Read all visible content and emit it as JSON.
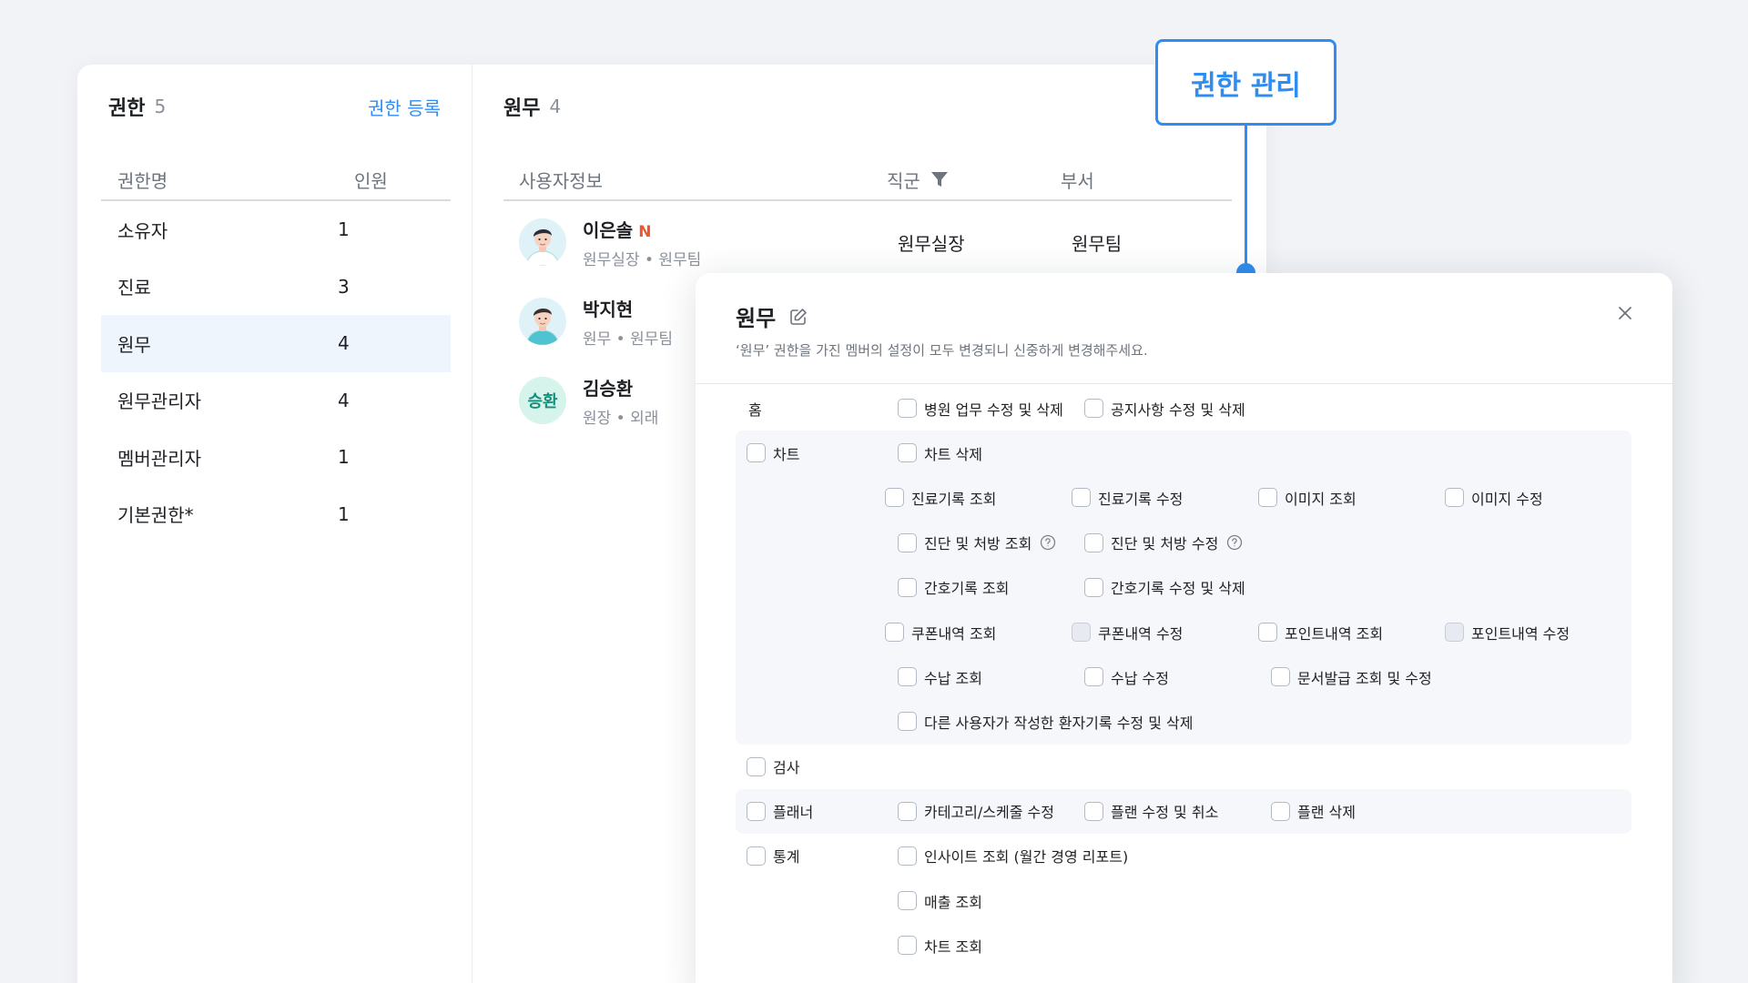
{
  "roles_panel": {
    "title": "권한",
    "count": "5",
    "register_label": "권한 등록",
    "col_name": "권한명",
    "col_count": "인원",
    "roles": [
      {
        "name": "소유자",
        "count": "1"
      },
      {
        "name": "진료",
        "count": "3"
      },
      {
        "name": "원무",
        "count": "4"
      },
      {
        "name": "원무관리자",
        "count": "4"
      },
      {
        "name": "멤버관리자",
        "count": "1"
      },
      {
        "name": "기본권한*",
        "count": "1"
      }
    ],
    "selected_index": 2
  },
  "members_panel": {
    "title": "원무",
    "count": "4",
    "col_user": "사용자정보",
    "col_rank": "직군",
    "col_dept": "부서",
    "members": [
      {
        "name": "이은솔",
        "badge": "N",
        "sub": "원무실장 • 원무팀",
        "rank": "원무실장",
        "dept": "원무팀",
        "avatar": "illustrated-avatar"
      },
      {
        "name": "박지현",
        "badge": "",
        "sub": "원무 • 원무팀",
        "rank": "",
        "dept": "",
        "avatar": "illustrated-avatar"
      },
      {
        "name": "김승환",
        "badge": "",
        "sub": "원장 • 외래",
        "rank": "",
        "dept": "",
        "avatar_text": "승환"
      }
    ]
  },
  "callout": {
    "label": "권한 관리",
    "color": "#2f8cf0"
  },
  "modal": {
    "title": "원무",
    "description": "‘원무’ 권한을 가진 멤버의 설정이 모두 변경되니 신중하게 변경해주세요.",
    "categories": [
      {
        "label": "홈",
        "checkbox": false,
        "shaded": false,
        "rows": [
          [
            "병원 업무 수정 및 삭제",
            "공지사항 수정 및 삭제"
          ]
        ]
      },
      {
        "label": "차트",
        "checkbox": true,
        "shaded": true,
        "rows": [
          [
            "차트 삭제"
          ],
          [
            "진료기록 조회",
            "진료기록 수정",
            "이미지 조회",
            "이미지 수정"
          ],
          [
            "진단 및 처방 조회",
            "진단 및 처방 수정"
          ],
          [
            "간호기록 조회",
            "간호기록 수정 및 삭제"
          ],
          [
            "쿠폰내역 조회",
            "쿠폰내역 수정",
            "포인트내역 조회",
            "포인트내역 수정"
          ],
          [
            "수납 조회",
            "수납 수정",
            "문서발급 조회 및 수정"
          ],
          [
            "다른 사용자가 작성한 환자기록 수정 및 삭제"
          ]
        ]
      },
      {
        "label": "검사",
        "checkbox": true,
        "shaded": false,
        "rows": [
          []
        ]
      },
      {
        "label": "플래너",
        "checkbox": true,
        "shaded": true,
        "rows": [
          [
            "카테고리/스케줄 수정",
            "플랜 수정 및 취소",
            "플랜 삭제"
          ]
        ]
      },
      {
        "label": "통계",
        "checkbox": true,
        "shaded": false,
        "rows": [
          [
            "인사이트 조회 (월간 경영 리포트)"
          ],
          [
            "매출 조회"
          ],
          [
            "차트 조회"
          ]
        ]
      }
    ],
    "disabled_items": [
      "쿠폰내역 수정",
      "포인트내역 수정"
    ],
    "help_items": [
      "진단 및 처방 조회",
      "진단 및 처방 수정"
    ]
  }
}
